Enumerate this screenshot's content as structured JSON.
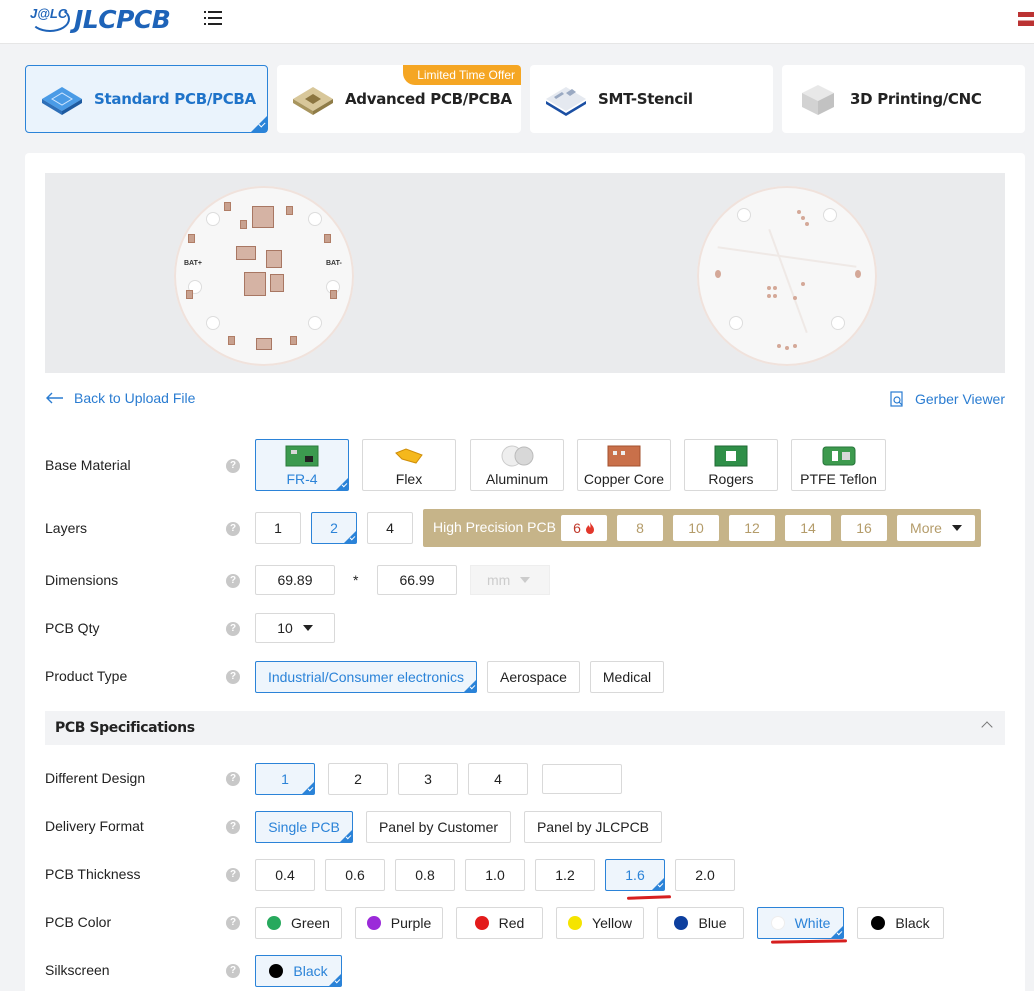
{
  "header": {
    "logo_mark": "J@LC",
    "logo_text": "JLCPCB"
  },
  "tabs": [
    {
      "label": "Standard PCB/PCBA"
    },
    {
      "label": "Advanced PCB/PCBA",
      "badge": "Limited Time Offer"
    },
    {
      "label": "SMT-Stencil"
    },
    {
      "label": "3D Printing/CNC"
    }
  ],
  "preview": {
    "silk_bat_plus": "BAT+",
    "silk_bat_minus": "BAT-"
  },
  "links": {
    "back": "Back to Upload File",
    "gerber": "Gerber Viewer"
  },
  "labels": {
    "base_material": "Base Material",
    "layers": "Layers",
    "dimensions": "Dimensions",
    "qty": "PCB Qty",
    "product_type": "Product Type",
    "different_design": "Different Design",
    "delivery_format": "Delivery Format",
    "thickness": "PCB Thickness",
    "color": "PCB Color",
    "silkscreen": "Silkscreen",
    "help": "?"
  },
  "base_material": [
    "FR-4",
    "Flex",
    "Aluminum",
    "Copper Core",
    "Rogers",
    "PTFE Teflon"
  ],
  "layers": [
    "1",
    "2",
    "4"
  ],
  "high_precision": {
    "title": "High Precision PCB",
    "options": [
      "6",
      "8",
      "10",
      "12",
      "14",
      "16"
    ],
    "more": "More"
  },
  "dimensions": {
    "x": "69.89",
    "sep": "*",
    "y": "66.99",
    "unit": "mm"
  },
  "qty": "10",
  "product_type": [
    "Industrial/Consumer electronics",
    "Aerospace",
    "Medical"
  ],
  "section_title": "PCB Specifications",
  "different_design": [
    "1",
    "2",
    "3",
    "4"
  ],
  "delivery_format": [
    "Single PCB",
    "Panel by Customer",
    "Panel by JLCPCB"
  ],
  "thickness": [
    "0.4",
    "0.6",
    "0.8",
    "1.0",
    "1.2",
    "1.6",
    "2.0"
  ],
  "colors": [
    {
      "label": "Green",
      "hex": "#27a95d"
    },
    {
      "label": "Purple",
      "hex": "#9b2ad9"
    },
    {
      "label": "Red",
      "hex": "#e31b1b"
    },
    {
      "label": "Yellow",
      "hex": "#f5e400"
    },
    {
      "label": "Blue",
      "hex": "#0d3f9e"
    },
    {
      "label": "White",
      "hex": "#ffffff"
    },
    {
      "label": "Black",
      "hex": "#000000"
    }
  ],
  "silkscreen": "Black",
  "accent": "#2b83d8"
}
